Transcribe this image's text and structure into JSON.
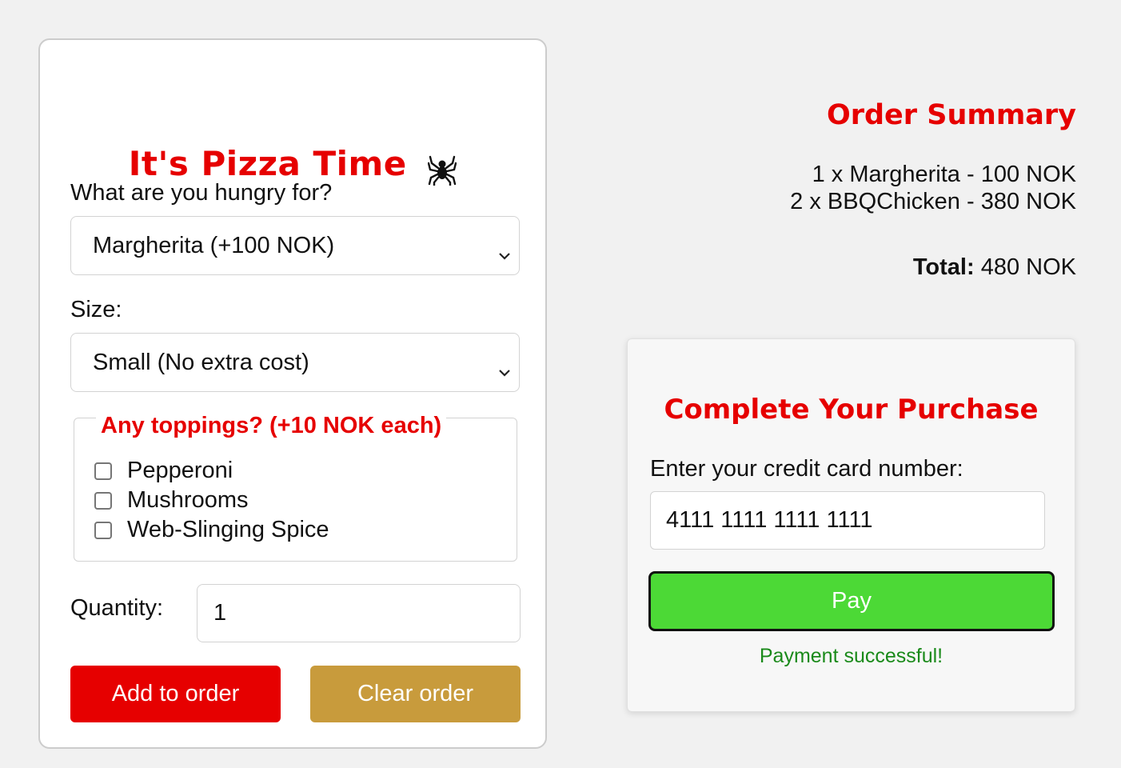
{
  "order_form": {
    "title": "It's Pizza Time",
    "title_icon": "spider-icon",
    "pizza_label": "What are you hungry for?",
    "pizza_selected": "Margherita (+100 NOK)",
    "size_label": "Size:",
    "size_selected": "Small (No extra cost)",
    "toppings_legend": "Any toppings? (+10 NOK each)",
    "toppings": [
      {
        "label": "Pepperoni",
        "checked": false
      },
      {
        "label": "Mushrooms",
        "checked": false
      },
      {
        "label": "Web-Slinging Spice",
        "checked": false
      }
    ],
    "quantity_label": "Quantity:",
    "quantity_value": "1",
    "add_button": "Add to order",
    "clear_button": "Clear order"
  },
  "summary": {
    "title": "Order Summary",
    "items": [
      "1 x Margherita - 100 NOK",
      "2 x BBQChicken - 380 NOK"
    ],
    "total_label": "Total:",
    "total_value": "480 NOK"
  },
  "payment": {
    "title": "Complete Your Purchase",
    "card_label": "Enter your credit card number:",
    "card_value": "4111 1111 1111 1111",
    "pay_button": "Pay",
    "status": "Payment successful!"
  },
  "colors": {
    "accent_red": "#e60000",
    "clear_gold": "#c89b3c",
    "pay_green": "#4cd936",
    "success_text": "#1a8a1a"
  }
}
